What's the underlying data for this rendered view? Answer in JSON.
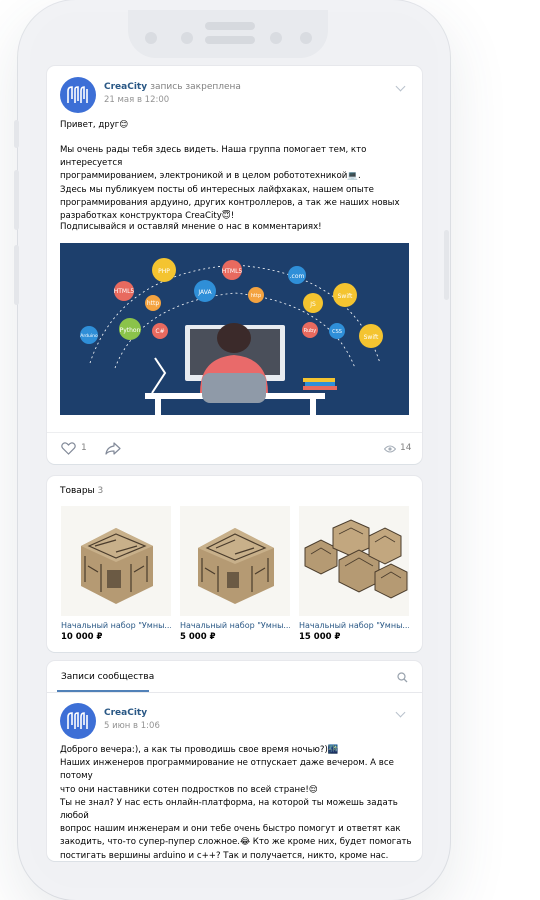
{
  "post": {
    "author": "CreaCity",
    "pinned_note": "запись закреплена",
    "date": "21 мая в 12:00",
    "greeting": "Привет, друг😊",
    "body": "Мы очень рады тебя здесь видеть. Наша группа помогает тем, кто интересуется\nпрограммированием, электроникой и в целом робототехникой💻.\nЗдесь мы публикуем посты об интересных лайфхаках, нашем опыте\nпрограммирования ардуино, других контроллеров, а так же наших новых\nразработках конструктора CreaCity😇!",
    "call_to_action": "Подписывайся и оставляй мнение о нас в комментариях!",
    "likes": "1",
    "views": "14",
    "image_labels": [
      "PHP",
      "HTML5",
      "JAVA",
      "HTML5",
      "http",
      "Arduino",
      "Python",
      "C#",
      ".com",
      "JS",
      "Swift",
      "Ruby",
      "CSS",
      "Swift",
      "http"
    ]
  },
  "goods": {
    "title": "Товары",
    "count": "3",
    "items": [
      {
        "name": "Начальный набор \"Умны...",
        "price": "10 000 ₽"
      },
      {
        "name": "Начальный набор \"Умны...",
        "price": "5 000 ₽"
      },
      {
        "name": "Начальный набор \"Умны...",
        "price": "15 000 ₽"
      }
    ]
  },
  "wall": {
    "tab_label": "Записи сообщества",
    "post": {
      "author": "CreaCity",
      "date": "5 июн в 1:06",
      "body": "Доброго вечера:), а как ты проводишь свое время ночью?)🌃\nНаших инженеров программирование не отпускает даже вечером. А все потому\nчто они наставники сотен подростков по всей стране!😌\nТы не знал? У нас есть онлайн-платформа, на которой ты можешь задать любой\nвопрос нашим инженерам и они тебе очень быстро помогут и ответят как\nзакодить, что-то супер-пупер сложное.😂 Кто же кроме них, будет помогать\nпостигать вершины arduino и c++? Так и получается, никто, кроме нас."
    }
  },
  "colors": {
    "link": "#2a5885",
    "accent": "#5181b8",
    "avatar": "#3d6fd6"
  }
}
